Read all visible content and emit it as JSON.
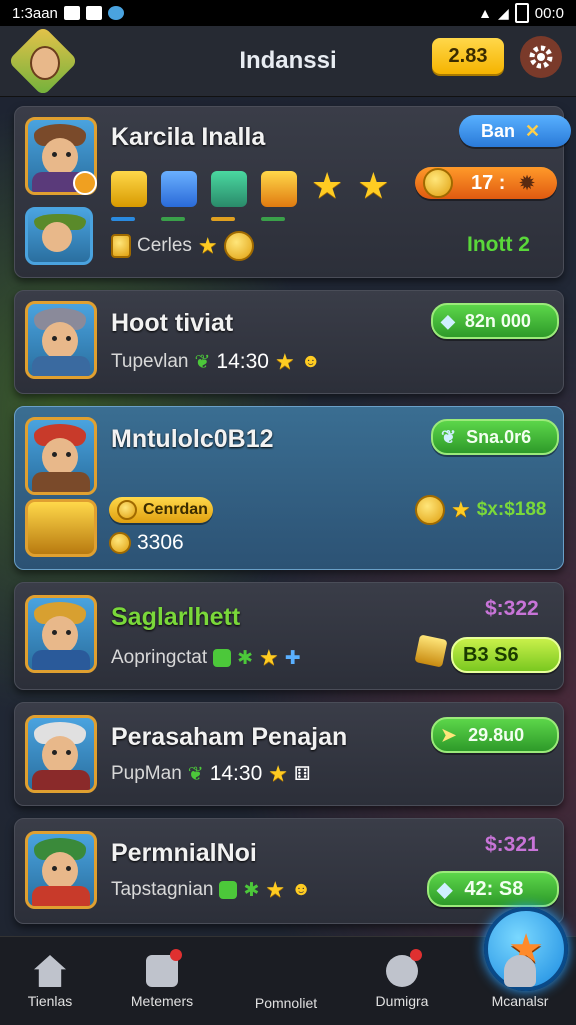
{
  "status_bar": {
    "time": "1:3aan",
    "clock": "00:0"
  },
  "header": {
    "title": "Indanssi",
    "coins": "2.83"
  },
  "cards": [
    {
      "name": "Karcila Inalla",
      "badge": "Ban",
      "counter": "17 :",
      "sub_label": "Cerles",
      "right_text": "Inott 2"
    },
    {
      "name": "Hoot tiviat",
      "badge": "82n 000",
      "sub_label": "Tupevlan",
      "sub_value": "14:30"
    },
    {
      "name": "Mntulolc0B12",
      "badge": "Sna.0r6",
      "tag": "Cenrdan",
      "amount": "3306",
      "right_text": "$x:$188"
    },
    {
      "name": "Saglarlhett",
      "price": "$:322",
      "sub_label": "Aopringctat",
      "badge": "B3  S6"
    },
    {
      "name": "Perasaham Penajan",
      "badge": "29.8u0",
      "sub_label": "PupMan",
      "sub_value": "14:30"
    },
    {
      "name": "PermnialNoi",
      "price": "$:321",
      "sub_label": "Tapstagnian",
      "badge": "42:  S8"
    }
  ],
  "nav": [
    {
      "label": "Tienlas",
      "icon": "home-icon"
    },
    {
      "label": "Metemers",
      "icon": "shop-icon"
    },
    {
      "label": "Pomnoliet",
      "icon": "star-icon"
    },
    {
      "label": "Dumigra",
      "icon": "mask-icon"
    },
    {
      "label": "Mcanalsr",
      "icon": "profile-icon"
    }
  ],
  "colors": {
    "accent_green": "#5cd64a",
    "accent_orange": "#ff9a2a",
    "price_purple": "#c874d8",
    "coin_gold": "#ffd84a"
  }
}
